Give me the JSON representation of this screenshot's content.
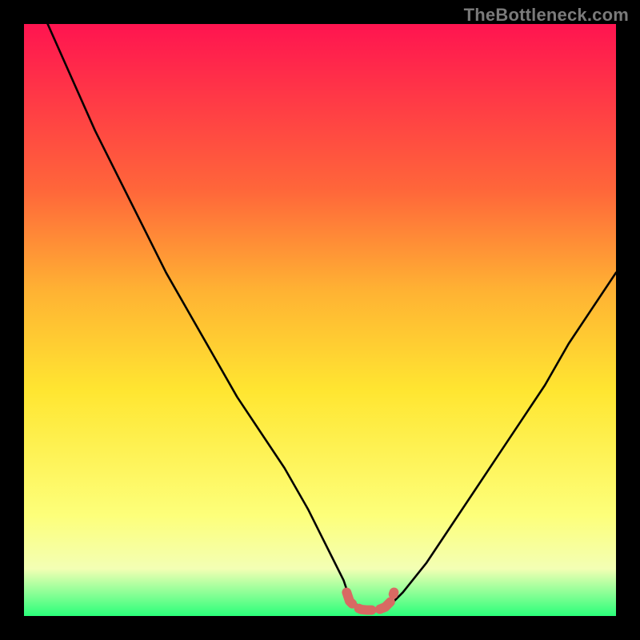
{
  "watermark": "TheBottleneck.com",
  "colors": {
    "bg_black": "#000000",
    "grad_top": "#ff1450",
    "grad_mid1": "#ff663a",
    "grad_mid2": "#ffb233",
    "grad_mid3": "#ffe631",
    "grad_mid4": "#fdff7a",
    "grad_mid5": "#f3ffb4",
    "grad_bottom": "#2aff7a",
    "curve": "#000000",
    "highlight": "#d86a63"
  },
  "chart_data": {
    "type": "line",
    "title": "",
    "xlabel": "",
    "ylabel": "",
    "xlim": [
      0,
      100
    ],
    "ylim": [
      0,
      100
    ],
    "series": [
      {
        "name": "bottleneck-curve",
        "x": [
          0,
          4,
          8,
          12,
          16,
          20,
          24,
          28,
          32,
          36,
          40,
          44,
          48,
          50,
          52,
          54,
          55,
          56,
          58,
          60,
          62,
          64,
          68,
          72,
          76,
          80,
          84,
          88,
          92,
          96,
          100
        ],
        "y": [
          110,
          100,
          91,
          82,
          74,
          66,
          58,
          51,
          44,
          37,
          31,
          25,
          18,
          14,
          10,
          6,
          3,
          2,
          1,
          1,
          2,
          4,
          9,
          15,
          21,
          27,
          33,
          39,
          46,
          52,
          58
        ]
      },
      {
        "name": "highlight-segment",
        "x": [
          54.5,
          55,
          56,
          57,
          58,
          59,
          60,
          61,
          62,
          62.5
        ],
        "y": [
          4,
          2.5,
          1.5,
          1.1,
          1,
          1,
          1.1,
          1.5,
          2.5,
          4
        ]
      }
    ],
    "gradient_stops": [
      {
        "offset": 0.0,
        "color_key": "grad_top"
      },
      {
        "offset": 0.28,
        "color_key": "grad_mid1"
      },
      {
        "offset": 0.45,
        "color_key": "grad_mid2"
      },
      {
        "offset": 0.62,
        "color_key": "grad_mid3"
      },
      {
        "offset": 0.83,
        "color_key": "grad_mid4"
      },
      {
        "offset": 0.92,
        "color_key": "grad_mid5"
      },
      {
        "offset": 1.0,
        "color_key": "grad_bottom"
      }
    ]
  }
}
